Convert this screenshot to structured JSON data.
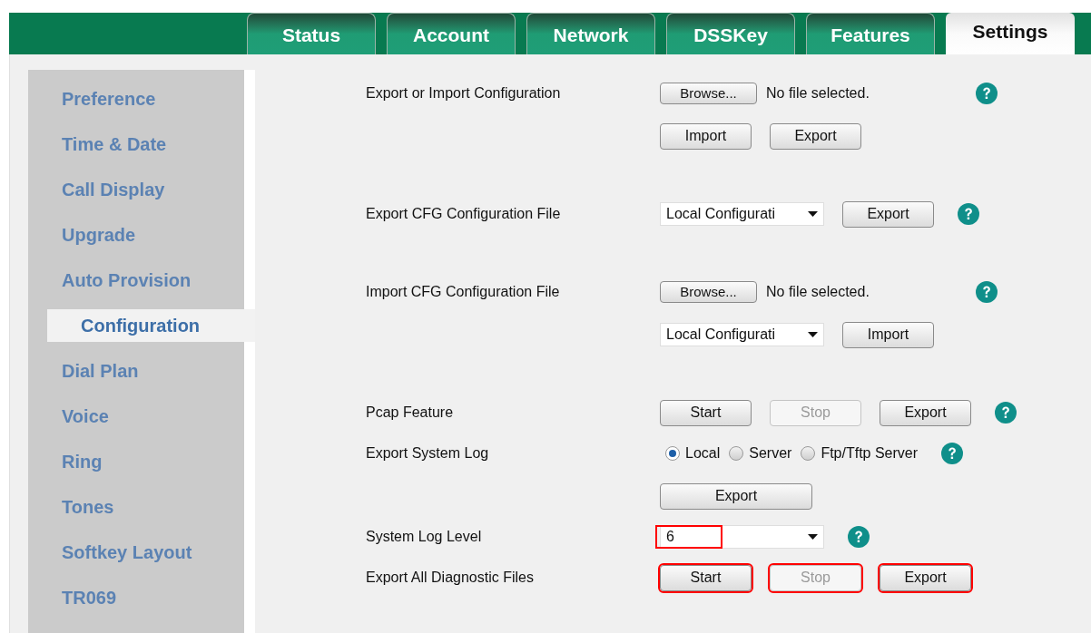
{
  "tabs": [
    {
      "label": "Status",
      "selected": false
    },
    {
      "label": "Account",
      "selected": false
    },
    {
      "label": "Network",
      "selected": false
    },
    {
      "label": "DSSKey",
      "selected": false
    },
    {
      "label": "Features",
      "selected": false
    },
    {
      "label": "Settings",
      "selected": true
    }
  ],
  "sidebar": {
    "items": [
      {
        "label": "Preference",
        "selected": false
      },
      {
        "label": "Time & Date",
        "selected": false
      },
      {
        "label": "Call Display",
        "selected": false
      },
      {
        "label": "Upgrade",
        "selected": false
      },
      {
        "label": "Auto Provision",
        "selected": false
      },
      {
        "label": "Configuration",
        "selected": true
      },
      {
        "label": "Dial Plan",
        "selected": false
      },
      {
        "label": "Voice",
        "selected": false
      },
      {
        "label": "Ring",
        "selected": false
      },
      {
        "label": "Tones",
        "selected": false
      },
      {
        "label": "Softkey Layout",
        "selected": false
      },
      {
        "label": "TR069",
        "selected": false
      }
    ]
  },
  "sections": [
    {
      "rows": [
        {
          "label": "Export or Import Configuration",
          "help": true,
          "lines": [
            [
              {
                "kind": "file",
                "button": "Browse...",
                "status": "No file selected."
              }
            ],
            [
              {
                "kind": "button",
                "label": "Import",
                "disabled": false,
                "highlighted": false
              },
              {
                "kind": "button",
                "label": "Export",
                "disabled": false,
                "highlighted": false
              }
            ]
          ]
        }
      ]
    },
    {
      "rows": [
        {
          "label": "Export CFG Configuration File",
          "help": true,
          "lines": [
            [
              {
                "kind": "select",
                "value": "Local Configurati",
                "highlighted": false
              },
              {
                "kind": "button",
                "label": "Export",
                "disabled": false,
                "highlighted": false
              }
            ]
          ]
        }
      ]
    },
    {
      "rows": [
        {
          "label": "Import CFG Configuration File",
          "help": true,
          "lines": [
            [
              {
                "kind": "file",
                "button": "Browse...",
                "status": "No file selected."
              }
            ],
            [
              {
                "kind": "select",
                "value": "Local Configurati",
                "highlighted": false
              },
              {
                "kind": "button",
                "label": "Import",
                "disabled": false,
                "highlighted": false
              }
            ]
          ]
        }
      ]
    },
    {
      "rows": [
        {
          "label": "Pcap Feature",
          "help": true,
          "lines": [
            [
              {
                "kind": "button",
                "label": "Start",
                "disabled": false,
                "highlighted": false
              },
              {
                "kind": "button",
                "label": "Stop",
                "disabled": true,
                "highlighted": false
              },
              {
                "kind": "button",
                "label": "Export",
                "disabled": false,
                "highlighted": false
              }
            ]
          ]
        },
        {
          "label": "Export System Log",
          "help": true,
          "lines": [
            [
              {
                "kind": "radio",
                "options": [
                  {
                    "label": "Local",
                    "selected": true
                  },
                  {
                    "label": "Server",
                    "selected": false
                  },
                  {
                    "label": "Ftp/Tftp Server",
                    "selected": false
                  }
                ]
              }
            ],
            [
              {
                "kind": "wide_button",
                "label": "Export",
                "disabled": false,
                "highlighted": false
              }
            ]
          ]
        },
        {
          "label": "System Log Level",
          "help": true,
          "lines": [
            [
              {
                "kind": "select",
                "value": "6",
                "highlighted": true
              }
            ]
          ]
        },
        {
          "label": "Export All Diagnostic Files",
          "help": false,
          "lines": [
            [
              {
                "kind": "button",
                "label": "Start",
                "disabled": false,
                "highlighted": true
              },
              {
                "kind": "button",
                "label": "Stop",
                "disabled": true,
                "highlighted": true
              },
              {
                "kind": "button",
                "label": "Export",
                "disabled": false,
                "highlighted": true
              }
            ]
          ]
        }
      ]
    }
  ]
}
